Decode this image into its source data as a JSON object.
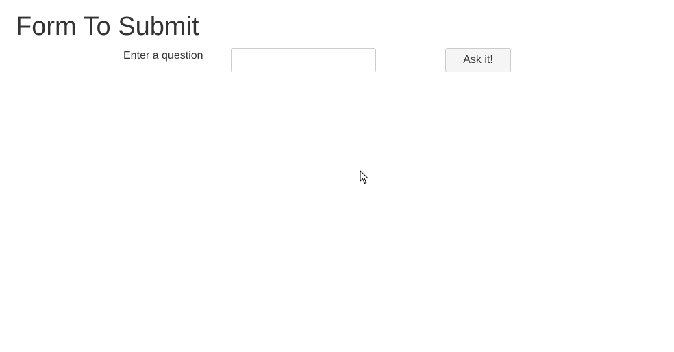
{
  "form": {
    "title": "Form To Submit",
    "question_label": "Enter a question",
    "question_value": "",
    "question_placeholder": "",
    "submit_label": "Ask it!"
  },
  "cursor": {
    "icon": "arrow-pointer-icon"
  }
}
